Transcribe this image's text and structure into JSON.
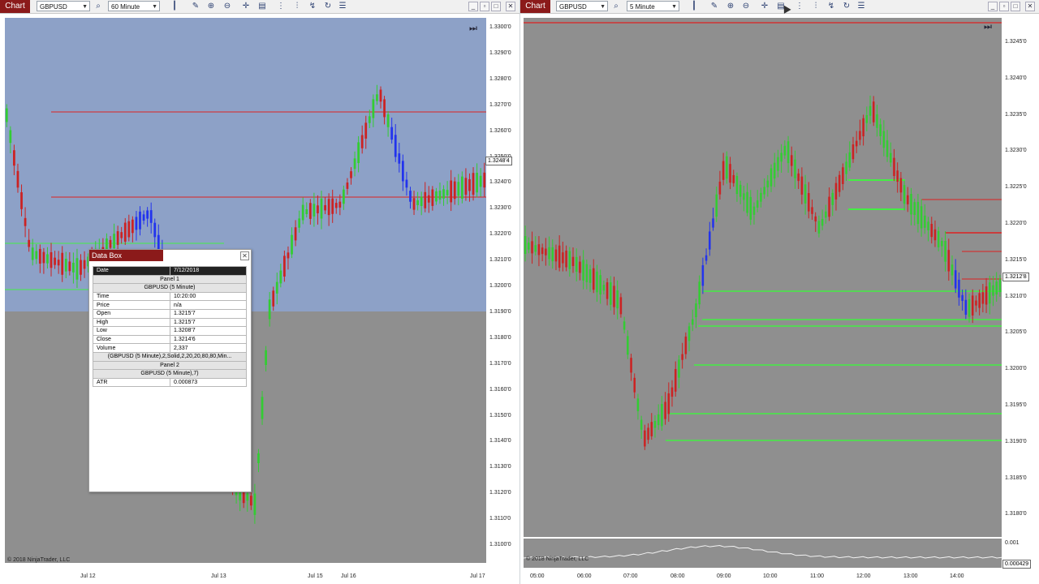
{
  "left_window": {
    "chart_button": "Chart",
    "instrument": "GBPUSD",
    "interval": "60 Minute",
    "y_axis_labels": [
      "1.3300'0",
      "1.3290'0",
      "1.3280'0",
      "1.3270'0",
      "1.3260'0",
      "1.3250'0",
      "1.3240'0",
      "1.3230'0",
      "1.3220'0",
      "1.3210'0",
      "1.3200'0",
      "1.3190'0",
      "1.3180'0",
      "1.3170'0",
      "1.3160'0",
      "1.3150'0",
      "1.3140'0",
      "1.3130'0",
      "1.3120'0",
      "1.3110'0",
      "1.3100'0"
    ],
    "current_price_tag": "1.3248'4",
    "x_axis_labels": [
      "Jul 12",
      "Jul 13",
      "Jul 15",
      "Jul 16",
      "Jul 17"
    ],
    "copyright": "© 2018 NinjaTrader, LLC"
  },
  "right_window": {
    "chart_button": "Chart",
    "instrument": "GBPUSD",
    "interval": "5 Minute",
    "y_axis_labels": [
      "1.3245'0",
      "1.3240'0",
      "1.3235'0",
      "1.3230'0",
      "1.3225'0",
      "1.3220'0",
      "1.3215'0",
      "1.3210'0",
      "1.3205'0",
      "1.3200'0",
      "1.3195'0",
      "1.3190'0",
      "1.3185'0",
      "1.3180'0"
    ],
    "current_price_tag": "1.3212'8",
    "x_axis_labels": [
      "05:00",
      "06:00",
      "07:00",
      "08:00",
      "09:00",
      "10:00",
      "11:00",
      "12:00",
      "13:00",
      "14:00"
    ],
    "indicator_axis_top": "0.001",
    "indicator_value_tag": "0.000429",
    "copyright": "© 2018 NinjaTrader, LLC"
  },
  "databox": {
    "title": "Data Box",
    "date_label": "Date",
    "date_value": "7/12/2018",
    "panel1_label": "Panel 1",
    "panel1_series": "GBPUSD (5 Minute)",
    "rows1": [
      {
        "label": "Time",
        "value": "10:20:00"
      },
      {
        "label": "Price",
        "value": "n/a"
      },
      {
        "label": "Open",
        "value": "1.3215'7"
      },
      {
        "label": "High",
        "value": "1.3215'7"
      },
      {
        "label": "Low",
        "value": "1.3208'7"
      },
      {
        "label": "Close",
        "value": "1.3214'6"
      },
      {
        "label": "Volume",
        "value": "2,337"
      }
    ],
    "indicator_series": "(GBPUSD (5 Minute),2,Solid,2,20,20,80,80,Min...",
    "panel2_label": "Panel 2",
    "panel2_series": "GBPUSD (5 Minute),7)",
    "rows2": [
      {
        "label": "ATR",
        "value": "0.000873"
      }
    ]
  },
  "colors": {
    "brand": "#8b1a1a",
    "plot_background": "#8f8f8f",
    "highlight_overlay": "#8da1c7",
    "up_candle": "#33cc33",
    "down_candle": "#cc2222",
    "volume_candle": "#2233ee",
    "level_line_green": "#44ee44",
    "level_line_red": "#dd2222"
  },
  "icons": [
    "chart-bars-icon",
    "pencil-icon",
    "zoom-in-icon",
    "zoom-out-icon",
    "crosshair-icon",
    "databox-icon",
    "properties-icon",
    "strategy-icon",
    "refresh-icon",
    "list-icon"
  ]
}
